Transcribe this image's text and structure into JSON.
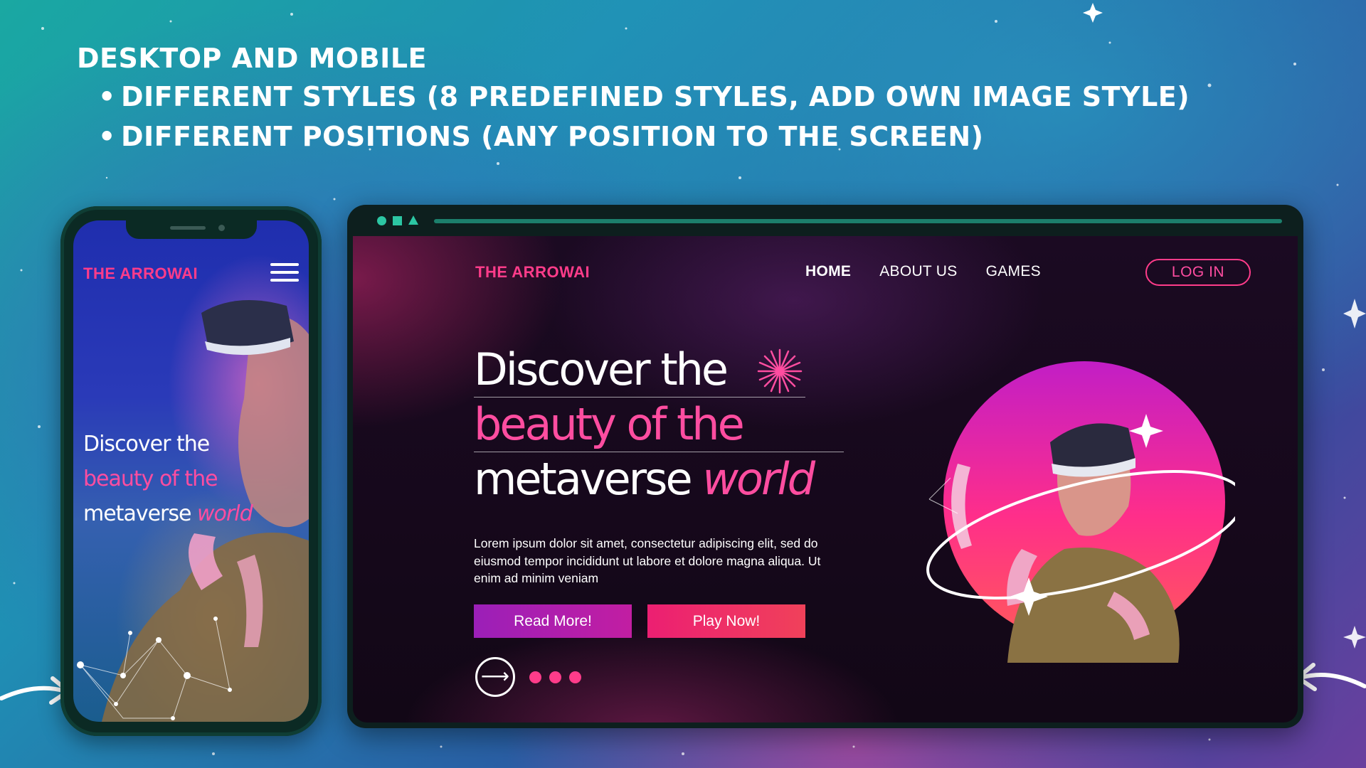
{
  "heading": {
    "title": "DESKTOP AND MOBILE",
    "bullets": [
      "DIFFERENT STYLES (8 PREDEFINED STYLES, ADD OWN IMAGE STYLE)",
      "DIFFERENT POSITIONS (ANY POSITION TO THE SCREEN)"
    ]
  },
  "mobile": {
    "brand": "THE ARROWAI",
    "menu_icon": "hamburger-menu-icon",
    "headline": {
      "line1": "Discover the",
      "line2": "beauty of the",
      "line3": "metaverse",
      "accent": "world"
    }
  },
  "desktop": {
    "window_controls": [
      "circle-icon",
      "square-icon",
      "triangle-icon"
    ],
    "brand": "THE ARROWAI",
    "nav": [
      {
        "label": "HOME",
        "active": true
      },
      {
        "label": "ABOUT US",
        "active": false
      },
      {
        "label": "GAMES",
        "active": false
      }
    ],
    "login_label": "LOG IN",
    "headline": {
      "line1": "Discover the",
      "line2": "beauty of the",
      "line3": "metaverse",
      "accent": "world"
    },
    "description": "Lorem ipsum dolor sit amet, consectetur adipiscing elit, sed do eiusmod tempor incididunt ut labore et dolore magna aliqua. Ut enim ad minim veniam",
    "read_more_label": "Read More!",
    "play_now_label": "Play Now!",
    "arrow_icon": "arrow-right-icon",
    "carousel_dots": 3
  },
  "colors": {
    "brand_pink": "#ff3c8a",
    "accent_pink": "#ff4da0",
    "read_more_purple": "#9b1fb8",
    "play_now_pink": "#ec1f72",
    "window_teal": "#2cc6a3"
  }
}
